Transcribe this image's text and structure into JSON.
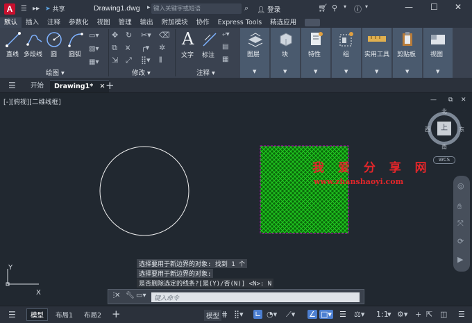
{
  "titlebar": {
    "logo": "A",
    "share": "共享",
    "doc_title": "Drawing1.dwg",
    "search_placeholder": "键入关键字或短语",
    "login": "登录"
  },
  "menu": {
    "items": [
      "默认",
      "插入",
      "注释",
      "参数化",
      "视图",
      "管理",
      "输出",
      "附加模块",
      "协作",
      "Express Tools",
      "精选应用"
    ]
  },
  "ribbon": {
    "draw_tools": {
      "line": "直线",
      "polyline": "多段线",
      "circle": "圆",
      "arc": "圆弧"
    },
    "draw_panel_title": "绘图",
    "modify_panel_title": "修改",
    "annotation": {
      "text": "文字",
      "dimension": "标注"
    },
    "annotation_panel_title": "注释",
    "layer": "图层",
    "block": "块",
    "properties": "特性",
    "group": "组",
    "utilities": "实用工具",
    "clipboard": "剪贴板",
    "view": "视图"
  },
  "doctabs": {
    "start": "开始",
    "drawing": "Drawing1*"
  },
  "viewport": {
    "label": "[-][俯视][二维线框]",
    "compass": {
      "north": "北",
      "south": "南",
      "east": "东",
      "west": "西",
      "top": "上",
      "wcs": "WCS"
    },
    "watermark_cn": "我 爱 分 享 网",
    "watermark_url": "www.zhanshaoyi.com",
    "cmd_history": [
      "选择要用于新边界的对象: 找到 1 个",
      "选择要用于新边界的对象:",
      "是否删除选定的线条?[是(Y)/否(N)] <N>: N"
    ],
    "ucs_x": "X",
    "ucs_y": "Y",
    "hatch_color": "#00b000",
    "hatch_border": "#c000c0"
  },
  "cmdbar": {
    "placeholder": "键入命令"
  },
  "statusbar": {
    "tabs": [
      "模型",
      "布局1",
      "布局2"
    ],
    "model_button": "模型",
    "scale": "1:1"
  }
}
